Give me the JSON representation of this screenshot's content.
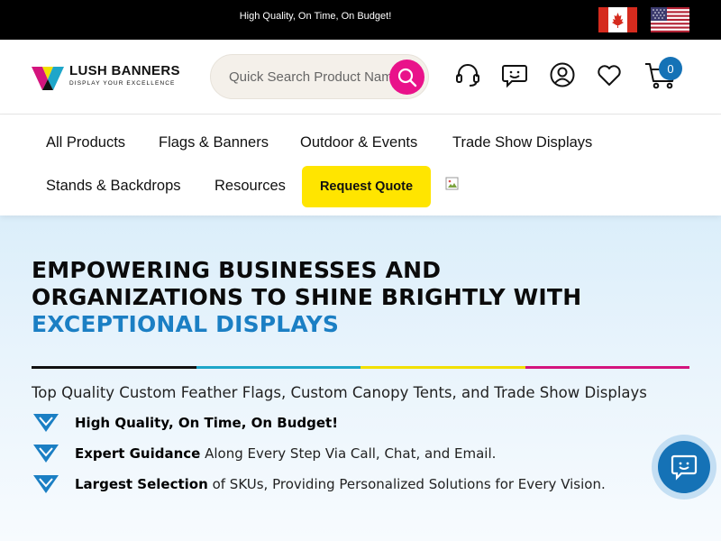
{
  "topbar": {
    "tagline": "High Quality, On Time, On Budget!",
    "flags": [
      "canada-flag",
      "usa-flag"
    ]
  },
  "header": {
    "logo": {
      "brand": "LUSH BANNERS",
      "tagline": "DISPLAY YOUR EXCELLENCE"
    },
    "search": {
      "placeholder": "Quick Search Product Name",
      "value": ""
    },
    "icons": [
      "support-headset-icon",
      "chat-icon",
      "account-icon",
      "wishlist-heart-icon",
      "cart-icon"
    ],
    "cart_count": "0"
  },
  "nav": {
    "items": [
      {
        "label": "All Products"
      },
      {
        "label": "Flags & Banners"
      },
      {
        "label": "Outdoor & Events"
      },
      {
        "label": "Trade Show Displays"
      },
      {
        "label": "Stands & Backdrops"
      },
      {
        "label": "Resources"
      }
    ],
    "quote_button": "Request Quote"
  },
  "hero": {
    "headline_line1": "EMPOWERING BUSINESSES AND",
    "headline_line2": "ORGANIZATIONS TO SHINE BRIGHTLY WITH",
    "headline_highlight": "EXCEPTIONAL DISPLAYS",
    "subtitle": "Top Quality Custom Feather Flags, Custom Canopy Tents, and Trade Show Displays",
    "bullets": [
      {
        "bold": "High Quality, On Time, On Budget!",
        "rest": ""
      },
      {
        "bold": "Expert Guidance",
        "rest": " Along Every Step Via Call, Chat, and Email."
      },
      {
        "bold": "Largest Selection",
        "rest": " of SKUs, Providing Personalized Solutions for Every Vision."
      }
    ]
  },
  "colors": {
    "accent_pink": "#e9128a",
    "accent_blue": "#1572b6",
    "highlight_blue": "#1b7fc4",
    "quote_yellow": "#ffe500",
    "divider": [
      "#111111",
      "#1ea6c9",
      "#f2e000",
      "#d4147e"
    ]
  }
}
